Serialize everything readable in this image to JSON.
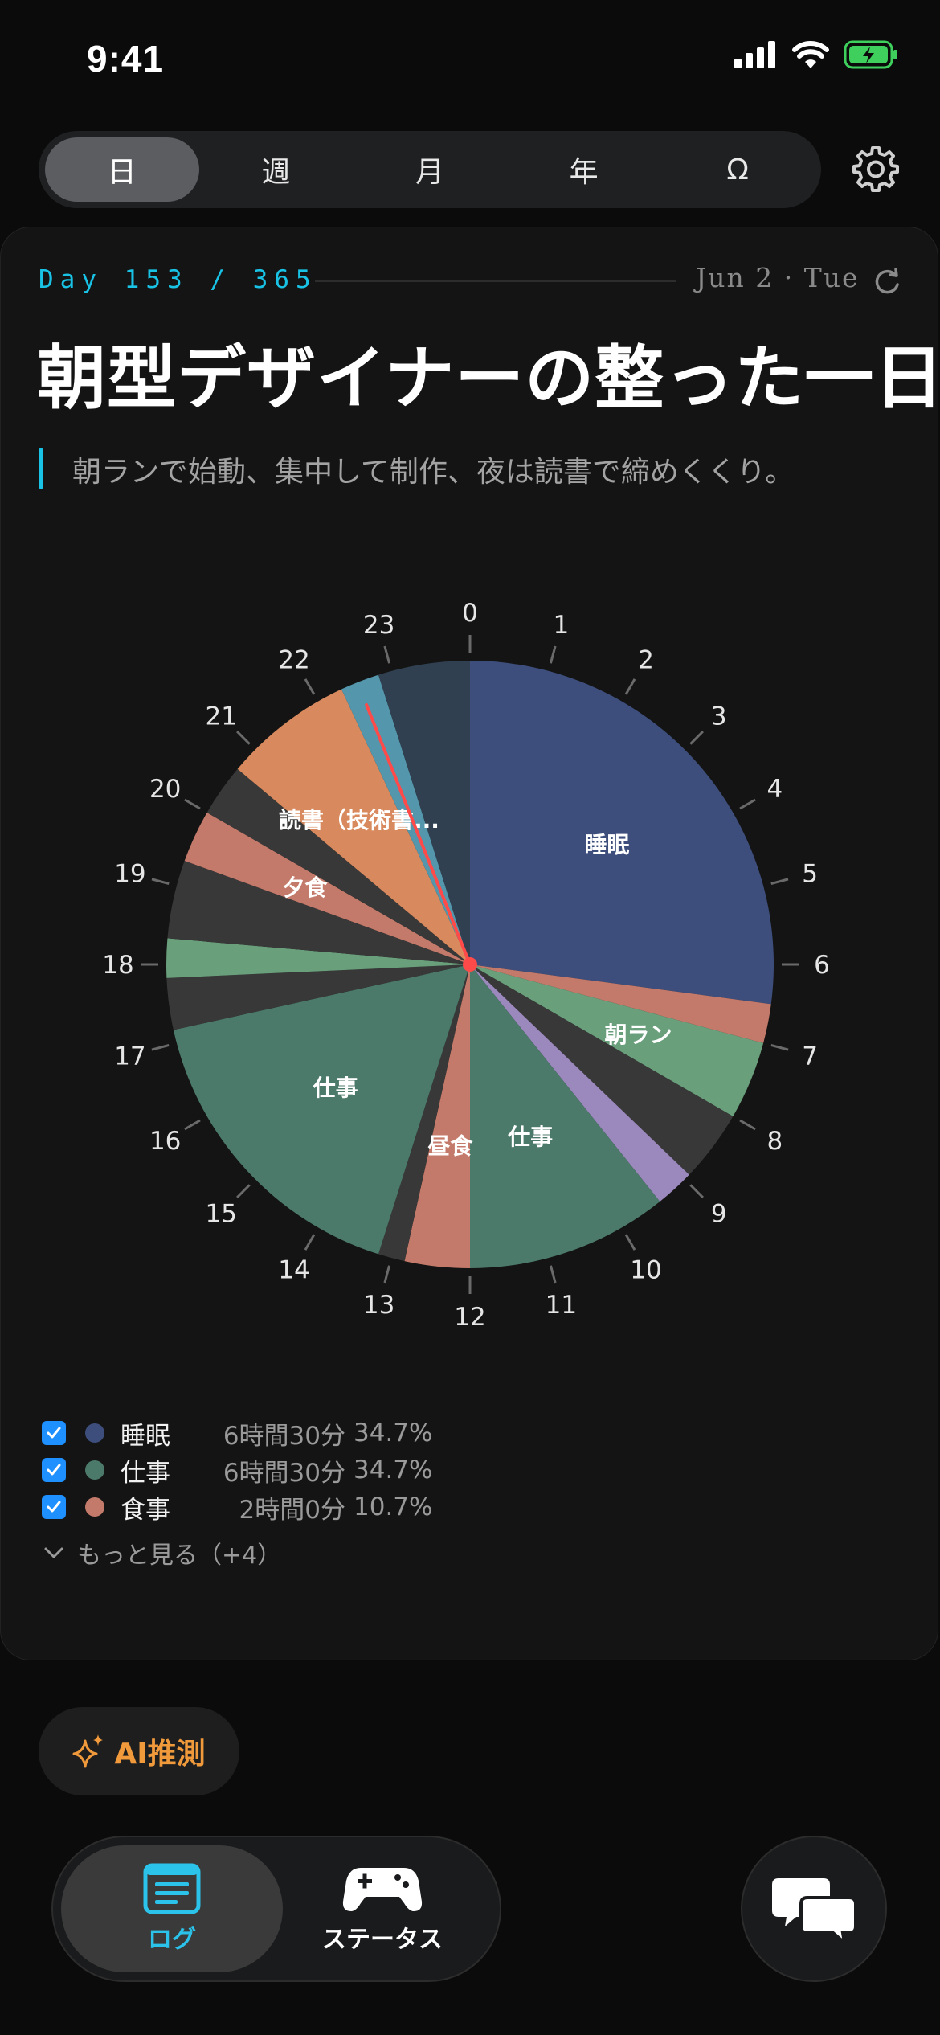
{
  "status": {
    "time": "9:41"
  },
  "segments": [
    {
      "label": "日",
      "active": true
    },
    {
      "label": "週",
      "active": false
    },
    {
      "label": "月",
      "active": false
    },
    {
      "label": "年",
      "active": false
    },
    {
      "label": "Ω",
      "active": false
    }
  ],
  "card": {
    "day": "Day 153 / 365",
    "date": "Jun 2 · Tue",
    "title": "朝型デザイナーの整った一日",
    "subtitle": "朝ランで始動、集中して制作、夜は読書で締めくくり。"
  },
  "chart_data": {
    "type": "pie",
    "hours_labels": [
      "0",
      "1",
      "2",
      "3",
      "4",
      "5",
      "6",
      "7",
      "8",
      "9",
      "10",
      "11",
      "12",
      "13",
      "14",
      "15",
      "16",
      "17",
      "18",
      "19",
      "20",
      "21",
      "22",
      "23"
    ],
    "slices": [
      {
        "start": 0,
        "end": 6.5,
        "color": "#3d4e7c",
        "label": "睡眠"
      },
      {
        "start": 6.5,
        "end": 7,
        "color": "#c47a6a",
        "label": ""
      },
      {
        "start": 7,
        "end": 8,
        "color": "#6a9f7c",
        "label": "朝ラン"
      },
      {
        "start": 8,
        "end": 8.92,
        "color": "#383838",
        "label": ""
      },
      {
        "start": 8.92,
        "end": 9.42,
        "color": "#9b88bd",
        "label": ""
      },
      {
        "start": 9.42,
        "end": 12,
        "color": "#4c7a6a",
        "label": "仕事"
      },
      {
        "start": 12,
        "end": 12.83,
        "color": "#c47a6a",
        "label": "昼食"
      },
      {
        "start": 12.83,
        "end": 13.17,
        "color": "#383838",
        "label": ""
      },
      {
        "start": 13.17,
        "end": 17.17,
        "color": "#4c7a6a",
        "label": "仕事"
      },
      {
        "start": 17.17,
        "end": 17.83,
        "color": "#383838",
        "label": ""
      },
      {
        "start": 17.83,
        "end": 18.33,
        "color": "#6a9f7c",
        "label": ""
      },
      {
        "start": 18.33,
        "end": 19.33,
        "color": "#383838",
        "label": ""
      },
      {
        "start": 19.33,
        "end": 20,
        "color": "#c47a6a",
        "label": "夕食"
      },
      {
        "start": 20,
        "end": 20.67,
        "color": "#383838",
        "label": ""
      },
      {
        "start": 20.67,
        "end": 22.33,
        "color": "#d88a5e",
        "label": "読書（技術書..."
      },
      {
        "start": 22.33,
        "end": 22.83,
        "color": "#5496ab",
        "label": ""
      },
      {
        "start": 22.83,
        "end": 24,
        "color": "#304050",
        "label": ""
      }
    ],
    "current_hour": 22.55,
    "title": "",
    "xlabel": "",
    "ylabel": ""
  },
  "legend": {
    "items": [
      {
        "name": "睡眠",
        "value": "6時間30分",
        "pct": "34.7%",
        "color": "#3d4e7c"
      },
      {
        "name": "仕事",
        "value": "6時間30分",
        "pct": "34.7%",
        "color": "#4c7a6a"
      },
      {
        "name": "食事",
        "value": "2時間0分",
        "pct": "10.7%",
        "color": "#c47a6a"
      }
    ],
    "more": "もっと見る（+4）"
  },
  "ai_button": "AI推測",
  "tabs": [
    {
      "label": "ログ",
      "icon": "list-icon"
    },
    {
      "label": "ステータス",
      "icon": "gamepad-icon"
    }
  ],
  "chat_icon": "chat-bubbles-icon"
}
